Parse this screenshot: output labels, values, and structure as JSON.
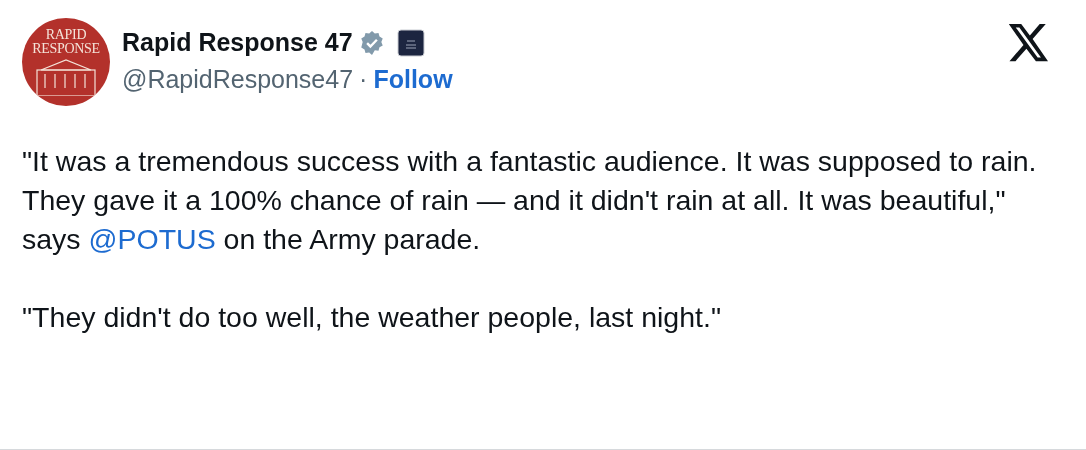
{
  "author": {
    "avatar": {
      "line_1": "RAPID",
      "line_2": "RESPONSE"
    },
    "name": "Rapid Response 47",
    "verified": true,
    "handle": "@RapidResponse47",
    "separator": "·",
    "follow": "Follow"
  },
  "post": {
    "paragraphs": [
      [
        {
          "kind": "text",
          "text": "\"It was a tremendous success with a fantastic audience. It was supposed to rain. They gave it a 100% chance of rain — and it didn't rain at all. It was beautiful,\" says "
        },
        {
          "kind": "link",
          "text": "@POTUS"
        },
        {
          "kind": "text",
          "text": " on the Army parade."
        }
      ],
      [
        {
          "kind": "text",
          "text": "\"They didn't do too well, the weather people, last night.\""
        }
      ]
    ]
  }
}
